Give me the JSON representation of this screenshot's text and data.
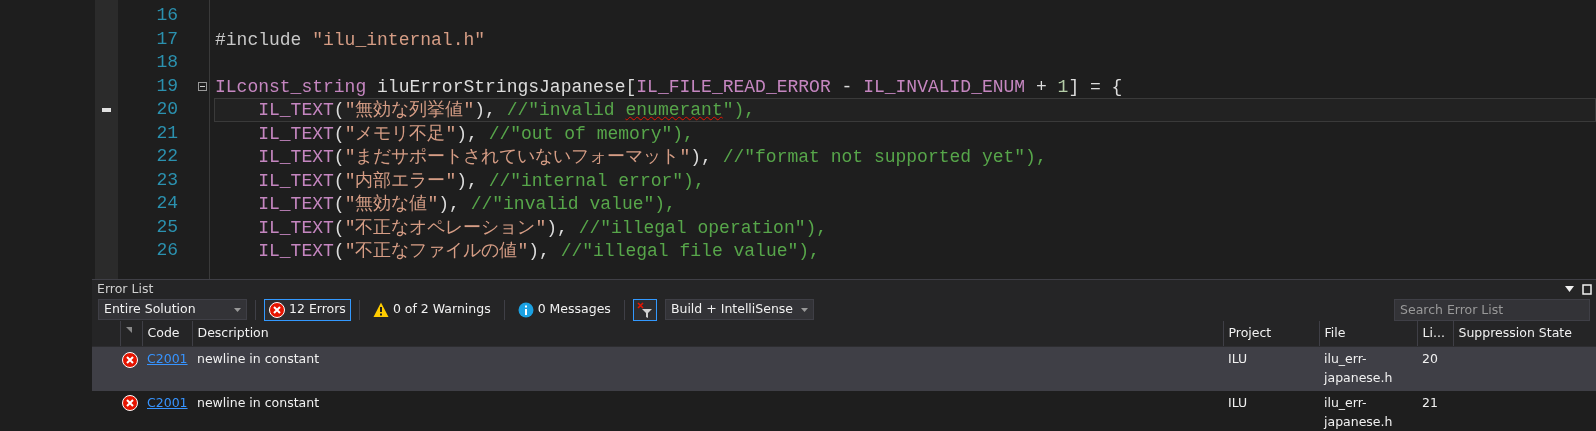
{
  "editor": {
    "lines": [
      {
        "number": "16",
        "current": false
      },
      {
        "number": "17",
        "current": false,
        "tokens": [
          {
            "kind": "preprocessor",
            "text": "#include "
          },
          {
            "kind": "string",
            "text": "\"ilu_internal.h\""
          }
        ]
      },
      {
        "number": "18",
        "current": false
      },
      {
        "number": "19",
        "current": false,
        "foldable": true,
        "tokens": [
          {
            "kind": "macro",
            "text": "ILconst_string"
          },
          {
            "kind": "plain",
            "text": " iluErrorStringsJapanese["
          },
          {
            "kind": "macro",
            "text": "IL_FILE_READ_ERROR"
          },
          {
            "kind": "plain",
            "text": " - "
          },
          {
            "kind": "macro",
            "text": "IL_INVALID_ENUM"
          },
          {
            "kind": "plain",
            "text": " + "
          },
          {
            "kind": "number",
            "text": "1"
          },
          {
            "kind": "plain",
            "text": "] = {"
          }
        ],
        "children": [
          {
            "number": "20",
            "current": true,
            "tokens": [
              {
                "kind": "macro",
                "text": "IL_TEXT"
              },
              {
                "kind": "plain",
                "text": "("
              },
              {
                "kind": "string",
                "text": "\"無効な列挙値\""
              },
              {
                "kind": "plain",
                "text": "), "
              },
              {
                "kind": "comment",
                "text": "//\"invalid "
              },
              {
                "kind": "comment",
                "text": "enumerant",
                "squiggle": true
              },
              {
                "kind": "comment",
                "text": "\"),"
              }
            ]
          },
          {
            "number": "21",
            "current": false,
            "tokens": [
              {
                "kind": "macro",
                "text": "IL_TEXT"
              },
              {
                "kind": "plain",
                "text": "("
              },
              {
                "kind": "string",
                "text": "\"メモリ不足\""
              },
              {
                "kind": "plain",
                "text": "), "
              },
              {
                "kind": "comment",
                "text": "//\"out of memory\"),"
              }
            ]
          },
          {
            "number": "22",
            "current": false,
            "tokens": [
              {
                "kind": "macro",
                "text": "IL_TEXT"
              },
              {
                "kind": "plain",
                "text": "("
              },
              {
                "kind": "string",
                "text": "\"まだサポートされていないフォーマット\""
              },
              {
                "kind": "plain",
                "text": "), "
              },
              {
                "kind": "comment",
                "text": "//\"format not supported yet\"),"
              }
            ]
          },
          {
            "number": "23",
            "current": false,
            "tokens": [
              {
                "kind": "macro",
                "text": "IL_TEXT"
              },
              {
                "kind": "plain",
                "text": "("
              },
              {
                "kind": "string",
                "text": "\"内部エラー\""
              },
              {
                "kind": "plain",
                "text": "), "
              },
              {
                "kind": "comment",
                "text": "//\"internal error\"),"
              }
            ]
          },
          {
            "number": "24",
            "current": false,
            "tokens": [
              {
                "kind": "macro",
                "text": "IL_TEXT"
              },
              {
                "kind": "plain",
                "text": "("
              },
              {
                "kind": "string",
                "text": "\"無効な値\""
              },
              {
                "kind": "plain",
                "text": "), "
              },
              {
                "kind": "comment",
                "text": "//\"invalid value\"),"
              }
            ]
          },
          {
            "number": "25",
            "current": false,
            "tokens": [
              {
                "kind": "macro",
                "text": "IL_TEXT"
              },
              {
                "kind": "plain",
                "text": "("
              },
              {
                "kind": "string",
                "text": "\"不正なオペレーション\""
              },
              {
                "kind": "plain",
                "text": "), "
              },
              {
                "kind": "comment",
                "text": "//\"illegal operation\"),"
              }
            ]
          },
          {
            "number": "26",
            "current": false,
            "tokens": [
              {
                "kind": "macro",
                "text": "IL_TEXT"
              },
              {
                "kind": "plain",
                "text": "("
              },
              {
                "kind": "string",
                "text": "\"不正なファイルの値\""
              },
              {
                "kind": "plain",
                "text": "), "
              },
              {
                "kind": "comment",
                "text": "//\"illegal file value\"),"
              }
            ]
          }
        ]
      }
    ]
  },
  "error_list": {
    "title": "Error List",
    "scope": "Entire Solution",
    "filters": [
      {
        "kind": "error",
        "label": "12 Errors",
        "selected": true
      },
      {
        "kind": "warning",
        "label": "0 of 2 Warnings",
        "selected": false
      },
      {
        "kind": "message",
        "label": "0 Messages",
        "selected": false
      }
    ],
    "filter_toggle": {
      "selected": true
    },
    "source": "Build + IntelliSense",
    "search": {
      "placeholder": "Search Error List"
    },
    "columns": [
      "Code",
      "Description",
      "Project",
      "File",
      "Li...",
      "Suppression State"
    ],
    "rows": [
      {
        "selected": true,
        "code": "C2001",
        "description": "newline in constant",
        "project": "ILU",
        "file": "ilu_err-japanese.h",
        "line": "20"
      },
      {
        "selected": false,
        "code": "C2001",
        "description": "newline in constant",
        "project": "ILU",
        "file": "ilu_err-japanese.h",
        "line": "21"
      }
    ]
  }
}
